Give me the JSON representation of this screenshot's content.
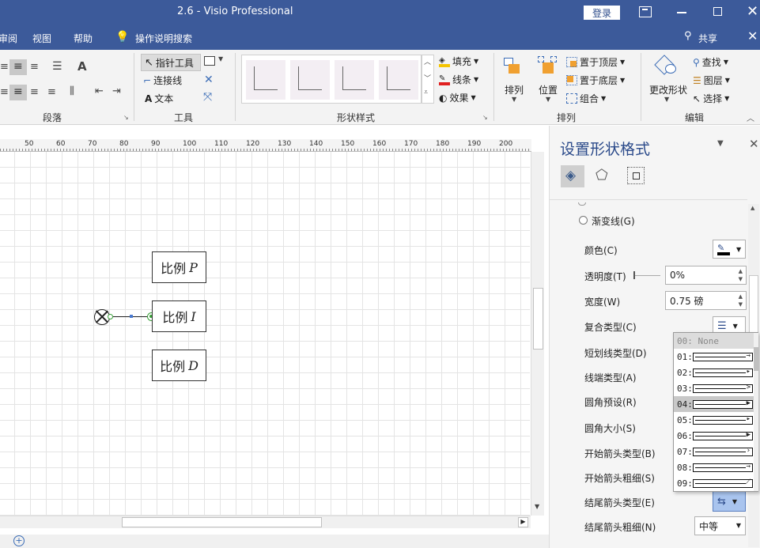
{
  "titlebar": {
    "doc_title": "2.6  -  Visio Professional",
    "login_label": "登录"
  },
  "menubar": {
    "items": [
      "审阅",
      "视图",
      "帮助"
    ],
    "search_label": "操作说明搜索",
    "share_label": "共享"
  },
  "ribbon": {
    "paragraph_group": "段落",
    "tools": {
      "pointer": "指针工具",
      "connector": "连接线",
      "text": "文本",
      "group_label": "工具"
    },
    "shape_styles_group": "形状样式",
    "fill_label": "填充",
    "line_label": "线条",
    "effect_label": "效果",
    "arrange": {
      "arrange_label": "排列",
      "position_label": "位置",
      "bring_front": "置于顶层",
      "send_back": "置于底层",
      "group": "组合",
      "group_label": "排列"
    },
    "edit": {
      "change_shape": "更改形状",
      "find": "查找",
      "layer": "图层",
      "select": "选择",
      "group_label": "编辑"
    }
  },
  "ruler": {
    "ticks": [
      "50",
      "60",
      "70",
      "80",
      "90",
      "100",
      "110",
      "120",
      "130",
      "140",
      "150",
      "160",
      "170",
      "180",
      "190",
      "200"
    ]
  },
  "diagram": {
    "shape_p": {
      "text": "比例",
      "var": "P"
    },
    "shape_i": {
      "text": "比例",
      "var": "I"
    },
    "shape_d": {
      "text": "比例",
      "var": "D"
    }
  },
  "panel": {
    "title": "设置形状格式",
    "gradient_line": "渐变线(G)",
    "color_label": "颜色(C)",
    "transparency_label": "透明度(T)",
    "transparency_value": "0%",
    "width_label": "宽度(W)",
    "width_value": "0.75 磅",
    "compound_label": "复合类型(C)",
    "dash_label": "短划线类型(D)",
    "cap_label": "线端类型(A)",
    "corner_preset_label": "圆角预设(R)",
    "corner_size_label": "圆角大小(S)",
    "begin_arrow_type": "开始箭头类型(B)",
    "begin_arrow_size": "开始箭头粗细(S)",
    "end_arrow_type": "结尾箭头类型(E)",
    "end_arrow_size": "结尾箭头粗细(N)",
    "end_arrow_size_value": "中等"
  },
  "arrow_dropdown": {
    "items": [
      "00: None",
      "01:",
      "02:",
      "03:",
      "04:",
      "05:",
      "06:",
      "07:",
      "08:",
      "09:"
    ],
    "selected_index": 4
  },
  "colors": {
    "title_blue": "#3c5a9a",
    "selected_blue": "#c5d7f0"
  }
}
